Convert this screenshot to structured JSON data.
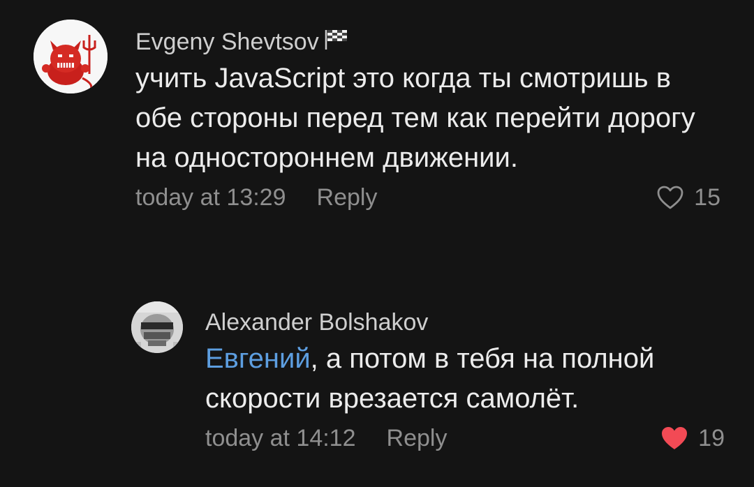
{
  "comments": [
    {
      "author": "Evgeny Shevtsov",
      "text": "учить JavaScript это когда ты смотришь в обе стороны перед тем как перейти дорогу на одностороннем движении.",
      "time": "today at 13:29",
      "reply_label": "Reply",
      "likes": "15",
      "liked": false,
      "badge_icon": "checkered-flag-icon"
    },
    {
      "author": "Alexander Bolshakov",
      "mention": "Евгений",
      "text": ", а потом в тебя на полной скорости врезается самолёт.",
      "time": "today at 14:12",
      "reply_label": "Reply",
      "likes": "19",
      "liked": true
    }
  ],
  "colors": {
    "background": "#141414",
    "mention": "#5d9ee0",
    "liked_heart": "#f24a55",
    "muted": "#8f8f8f"
  }
}
